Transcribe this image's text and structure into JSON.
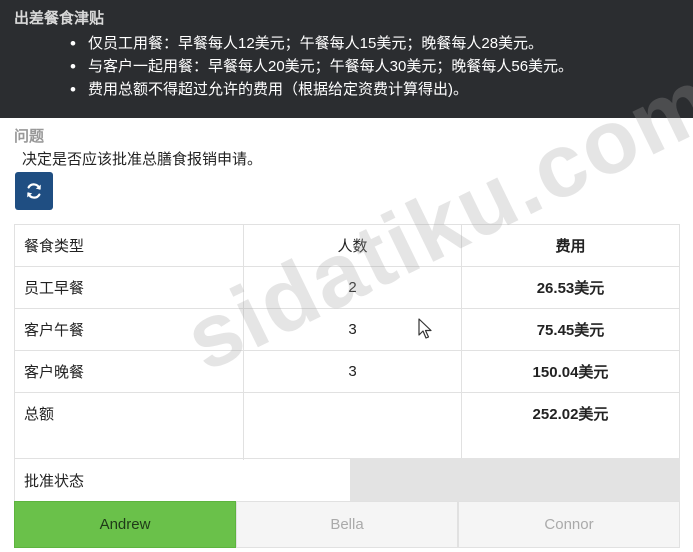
{
  "header": {
    "title": "出差餐食津贴",
    "rules": [
      "仅员工用餐：早餐每人12美元；午餐每人15美元；晚餐每人28美元。",
      "与客户一起用餐：早餐每人20美元；午餐每人30美元；晚餐每人56美元。",
      "费用总额不得超过允许的费用（根据给定资费计算得出)。"
    ]
  },
  "question": {
    "label": "问题",
    "text": "决定是否应该批准总膳食报销申请。"
  },
  "refresh_icon": "refresh-icon",
  "table": {
    "headers": [
      "餐食类型",
      "人数",
      "费用"
    ],
    "rows": [
      {
        "type": "员工早餐",
        "count": "2",
        "cost": "26.53美元"
      },
      {
        "type": "客户午餐",
        "count": "3",
        "cost": "75.45美元"
      },
      {
        "type": "客户晚餐",
        "count": "3",
        "cost": "150.04美元"
      },
      {
        "type": "总额",
        "count": "",
        "cost": "252.02美元"
      }
    ]
  },
  "approval": {
    "label": "批准状态",
    "value": ""
  },
  "choices": [
    {
      "name": "Andrew",
      "selected": true
    },
    {
      "name": "Bella",
      "selected": false
    },
    {
      "name": "Connor",
      "selected": false
    }
  ],
  "watermark": "sidatiku.com",
  "colors": {
    "header_bg": "#2b2d30",
    "button_bg": "#1f4e82",
    "selected_bg": "#6ac14a"
  }
}
